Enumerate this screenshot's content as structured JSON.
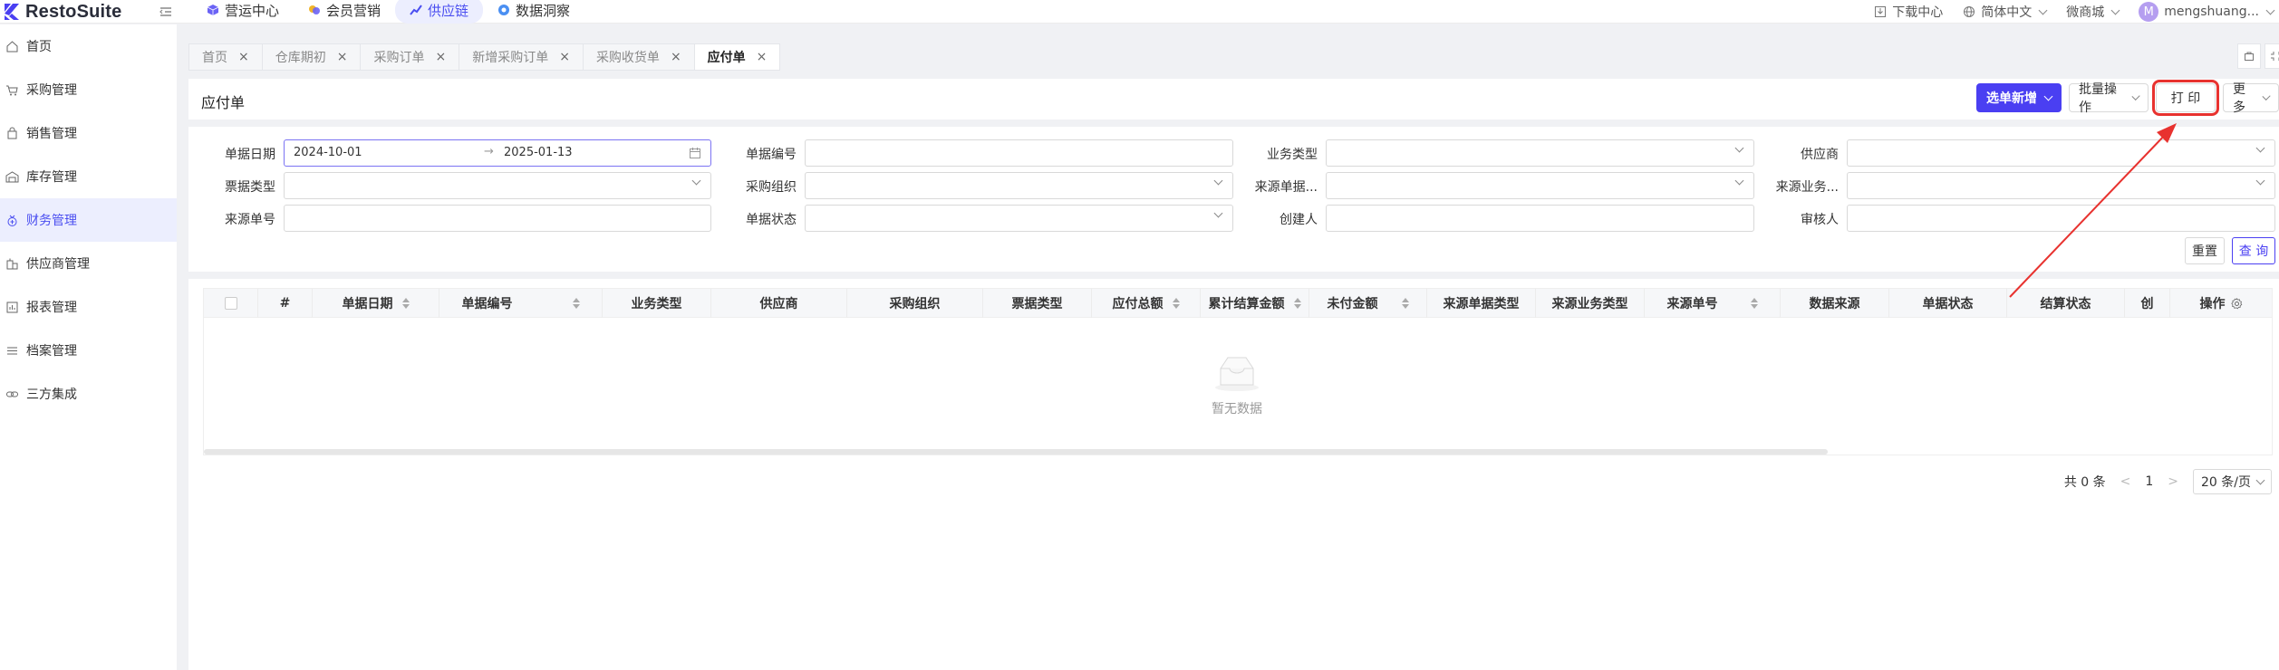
{
  "brand": {
    "name": "RestoSuite",
    "accent": "#4a3ff2",
    "annotation_color": "#e8322f"
  },
  "top_nav": [
    {
      "label": "营运中心",
      "icon": "cube-icon"
    },
    {
      "label": "会员营销",
      "icon": "gem-icon"
    },
    {
      "label": "供应链",
      "icon": "chart-icon",
      "active": true
    },
    {
      "label": "数据洞察",
      "icon": "eye-icon"
    }
  ],
  "top_right": {
    "download": "下载中心",
    "language": "简体中文",
    "store": "微商城",
    "avatar_letter": "M",
    "user": "mengshuang..."
  },
  "sidebar": [
    {
      "label": "首页",
      "icon": "home-icon"
    },
    {
      "label": "采购管理",
      "icon": "cart-icon"
    },
    {
      "label": "销售管理",
      "icon": "bag-icon"
    },
    {
      "label": "库存管理",
      "icon": "warehouse-icon"
    },
    {
      "label": "财务管理",
      "icon": "money-icon",
      "active": true
    },
    {
      "label": "供应商管理",
      "icon": "building-icon"
    },
    {
      "label": "报表管理",
      "icon": "report-icon"
    },
    {
      "label": "档案管理",
      "icon": "list-icon"
    },
    {
      "label": "三方集成",
      "icon": "link-icon"
    }
  ],
  "tabs": [
    {
      "label": "首页",
      "close": "×"
    },
    {
      "label": "仓库期初",
      "close": "×"
    },
    {
      "label": "采购订单",
      "close": "×"
    },
    {
      "label": "新增采购订单",
      "close": "×"
    },
    {
      "label": "采购收货单",
      "close": "×"
    },
    {
      "label": "应付单",
      "close": "×",
      "active": true
    }
  ],
  "page": {
    "title": "应付单",
    "btn_select_add": "选单新增",
    "btn_batch": "批量操作",
    "btn_print": "打 印",
    "btn_more": "更多"
  },
  "filter": {
    "doc_date_label": "单据日期",
    "date_start": "2024-10-01",
    "date_arrow": "→",
    "date_end": "2025-01-13",
    "doc_no_label": "单据编号",
    "biz_type_label": "业务类型",
    "supplier_label": "供应商",
    "invoice_type_label": "票据类型",
    "purchase_org_label": "采购组织",
    "source_doc_type_label": "来源单据...",
    "source_biz_label": "来源业务...",
    "source_no_label": "来源单号",
    "doc_status_label": "单据状态",
    "creator_label": "创建人",
    "auditor_label": "审核人",
    "btn_reset": "重置",
    "btn_query": "查 询"
  },
  "table": {
    "columns": [
      "#",
      "单据日期",
      "单据编号",
      "业务类型",
      "供应商",
      "采购组织",
      "票据类型",
      "应付总额",
      "累计结算金额",
      "未付金额",
      "来源单据类型",
      "来源业务类型",
      "来源单号",
      "数据来源",
      "单据状态",
      "结算状态",
      "创",
      "操作"
    ],
    "empty_text": "暂无数据"
  },
  "pager": {
    "total": "共 0 条",
    "page": "1",
    "page_size": "20 条/页",
    "prev": "<",
    "next": ">"
  }
}
